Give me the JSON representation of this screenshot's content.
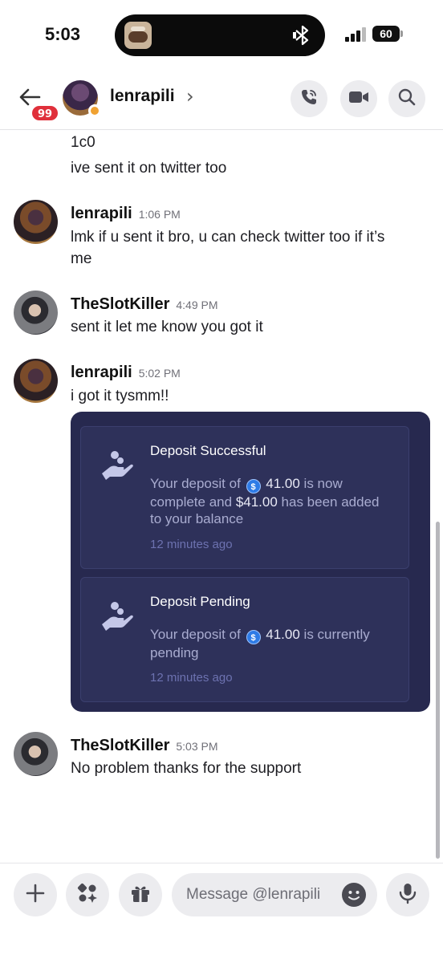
{
  "status_bar": {
    "time": "5:03",
    "battery": "60",
    "island_icon": "bluetooth-icon"
  },
  "header": {
    "back_icon": "arrow-left-icon",
    "unread_badge": "99",
    "channel_name": "lenrapili",
    "chevron": "›",
    "buttons": [
      "call-icon",
      "video-icon",
      "search-icon"
    ]
  },
  "messages": {
    "continuation": [
      "1c0",
      "ive sent it on twitter too"
    ],
    "groups": [
      {
        "author": "lenrapili",
        "time": "1:06 PM",
        "lines": [
          "lmk if u sent it bro, u can check twitter too if it’s",
          "me"
        ]
      },
      {
        "author": "TheSlotKiller",
        "time": "4:49 PM",
        "lines": [
          "sent it let me know you got it"
        ]
      },
      {
        "author": "lenrapili",
        "time": "5:02 PM",
        "lines": [
          "i got it tysmm!!"
        ]
      },
      {
        "author": "TheSlotKiller",
        "time": "5:03 PM",
        "lines": [
          "No problem thanks for the support"
        ]
      }
    ]
  },
  "embed": {
    "cards": [
      {
        "title": "Deposit Successful",
        "text_a": "Your deposit of",
        "amount": "41.00",
        "text_b": "is now complete and",
        "highlight": "$41.00",
        "text_c": "has been added to your balance",
        "time": "12 minutes ago"
      },
      {
        "title": "Deposit Pending",
        "text_a": "Your deposit of",
        "amount": "41.00",
        "text_b": "is currently pending",
        "time": "12 minutes ago"
      }
    ],
    "colors": {
      "background": "#27294f",
      "card": "#2e315a",
      "accent": "#a9acd0"
    }
  },
  "composer": {
    "placeholder": "Message @lenrapili",
    "buttons": [
      "plus-icon",
      "apps-icon",
      "gift-icon",
      "emoji-icon",
      "microphone-icon"
    ]
  }
}
